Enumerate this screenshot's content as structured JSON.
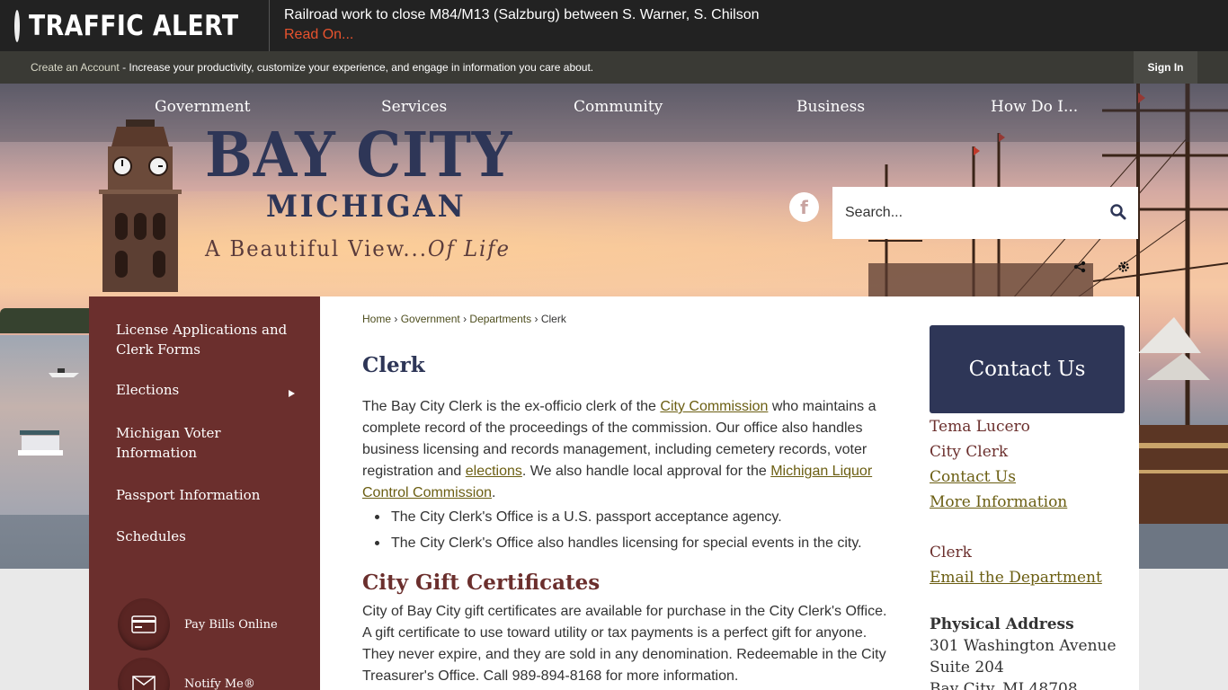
{
  "alert": {
    "title": "TRAFFIC ALERT",
    "message": "Railroad work to close M84/M13 (Salzburg) between S. Warner, S. Chilson",
    "link": "Read On..."
  },
  "account": {
    "create_link": "Create an Account",
    "message": " - Increase your productivity, customize your experience, and engage in information you care about.",
    "sign_in": "Sign In"
  },
  "nav": [
    "Government",
    "Services",
    "Community",
    "Business",
    "How Do I..."
  ],
  "logo": {
    "line1": "BAY CITY",
    "line2": "MICHIGAN",
    "tagline_start": "A Beautiful View...",
    "tagline_end": "Of Life"
  },
  "social": {
    "facebook": "f"
  },
  "search": {
    "placeholder": "Search..."
  },
  "sidebar": {
    "items": [
      "License Applications and Clerk Forms",
      "Elections",
      "Michigan Voter Information",
      "Passport Information",
      "Schedules"
    ],
    "quick_links": [
      "Pay Bills Online",
      "Notify Me®"
    ]
  },
  "breadcrumb": {
    "home": "Home",
    "government": "Government",
    "departments": "Departments",
    "current": "Clerk",
    "sep": "›"
  },
  "page": {
    "title": "Clerk",
    "intro_1": "The Bay City Clerk is the ex-officio clerk of the ",
    "intro_link_1": "City Commission",
    "intro_2": " who maintains a complete record of the proceedings of the commission. Our office also handles business licensing and records management, including cemetery records, voter registration and ",
    "intro_link_2": "elections",
    "intro_3": ". We also handle local approval for the ",
    "intro_link_3": "Michigan Liquor Control Commission",
    "intro_4": ".",
    "bullets": [
      "The City Clerk's Office is a U.S. passport acceptance agency.",
      "The City Clerk's Office also handles licensing for special events in the city."
    ],
    "section_title": "City Gift Certificates",
    "section_body": "City of Bay City gift certificates are available for purchase in the City Clerk's Office. A gift certificate to use toward utility or tax payments is a perfect gift for anyone. They never expire, and they are sold in any denomination. Redeemable in the City Treasurer's Office. Call 989-894-8168 for more information."
  },
  "contact": {
    "heading": "Contact Us",
    "name": "Tema Lucero",
    "role": "City Clerk",
    "contact_link": "Contact Us",
    "more_link": "More Information",
    "dept": "Clerk",
    "email_link": "Email the Department",
    "address_label": "Physical Address",
    "address_1": "301 Washington Avenue",
    "address_2": "Suite 204",
    "address_3": "Bay City, MI 48708"
  },
  "colors": {
    "alert_bg": "#222222",
    "alert_link": "#e8532e",
    "sidebar": "#6b2f2d",
    "navy": "#2e3657",
    "link_olive": "#6b5e12"
  },
  "icons": [
    "alert-light-icon",
    "facebook-icon",
    "search-icon",
    "share-icon",
    "settings-icon",
    "credit-card-icon",
    "envelope-icon"
  ]
}
